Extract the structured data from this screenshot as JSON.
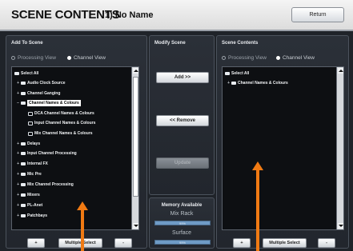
{
  "header": {
    "title": "SCENE CONTENTS",
    "scene_name": "1) No Name",
    "return_label": "Return"
  },
  "left_panel": {
    "title": "Add To Scene",
    "view_processing": "Processing View",
    "view_channel": "Channel View",
    "items": [
      {
        "label": "Select All"
      },
      {
        "label": "Audio Clock Source"
      },
      {
        "label": "Channel Ganging"
      },
      {
        "label": "Channel Names & Colours"
      },
      {
        "label": "DCA Channel Names & Colours"
      },
      {
        "label": "Input Channel Names & Colours"
      },
      {
        "label": "Mix Channel Names & Colours"
      },
      {
        "label": "Delays"
      },
      {
        "label": "Input Channel Processing"
      },
      {
        "label": "Internal FX"
      },
      {
        "label": "Mic Pre"
      },
      {
        "label": "Mix Channel Processing"
      },
      {
        "label": "Mixers"
      },
      {
        "label": "PL-Anet"
      },
      {
        "label": "Patchbays"
      }
    ],
    "plus_label": "+",
    "multi_select_label": "Multiple Select",
    "minus_label": "-"
  },
  "mid_panel": {
    "title": "Modify Scene",
    "add_label": "Add >>",
    "remove_label": "<< Remove",
    "update_label": "Update"
  },
  "memory": {
    "title": "Memory Available",
    "mix_rack_label": "Mix Rack",
    "mix_rack_value": "99%",
    "surface_label": "Surface",
    "surface_value": "99%"
  },
  "right_panel": {
    "title": "Scene Contents",
    "view_processing": "Processing View",
    "view_channel": "Channel View",
    "items": [
      {
        "label": "Select All"
      },
      {
        "label": "Channel Names & Colours"
      }
    ],
    "plus_label": "+",
    "multi_select_label": "Multiple Select",
    "minus_label": "-"
  },
  "colors": {
    "annotation_arrow": "#f07a13"
  }
}
